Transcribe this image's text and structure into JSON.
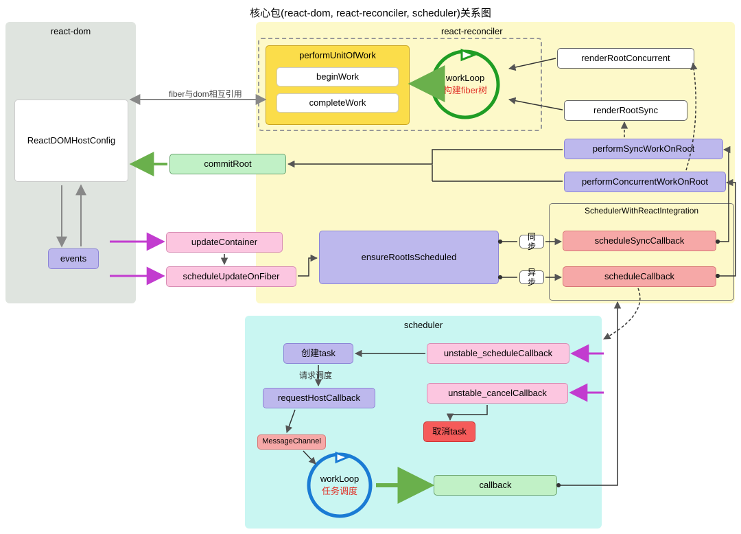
{
  "title": "核心包(react-dom, react-reconciler, scheduler)关系图",
  "panels": {
    "dom": {
      "label": "react-dom"
    },
    "reconciler": {
      "label": "react-reconciler"
    },
    "scheduler": {
      "label": "scheduler"
    },
    "swri": {
      "label": "SchedulerWithReactIntegration"
    }
  },
  "nodes": {
    "reactDomHostConfig": "ReactDOMHostConfig",
    "events": "events",
    "commitRoot": "commitRoot",
    "updateContainer": "updateContainer",
    "scheduleUpdateOnFiber": "scheduleUpdateOnFiber",
    "performUnitOfWork": "performUnitOfWork",
    "beginWork": "beginWork",
    "completeWork": "completeWork",
    "workLoopReconciler": {
      "name": "workLoop",
      "sub": "构建fiber树"
    },
    "renderRootConcurrent": "renderRootConcurrent",
    "renderRootSync": "renderRootSync",
    "performSyncWorkOnRoot": "performSyncWorkOnRoot",
    "performConcurrentWorkOnRoot": "performConcurrentWorkOnRoot",
    "ensureRootIsScheduled": "ensureRootIsScheduled",
    "scheduleSyncCallback": "scheduleSyncCallback",
    "scheduleCallback": "scheduleCallback",
    "createTask": "创建task",
    "requestHostCallback": "requestHostCallback",
    "messageChannel": "MessageChannel",
    "workLoopScheduler": {
      "name": "workLoop",
      "sub": "任务调度"
    },
    "callback": "callback",
    "unstableSchedule": "unstable_scheduleCallback",
    "unstableCancel": "unstable_cancelCallback",
    "cancelTask": "取消task"
  },
  "labels": {
    "fiberDom": "fiber与dom相互引用",
    "sync": "同步",
    "async": "异步",
    "requestSchedule": "请求调度"
  }
}
